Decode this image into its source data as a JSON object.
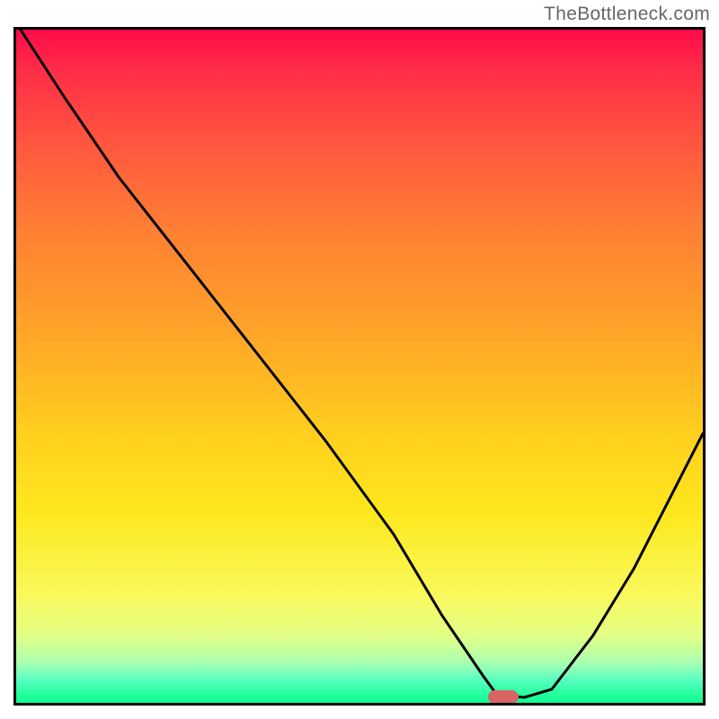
{
  "watermark": "TheBottleneck.com",
  "chart_data": {
    "type": "line",
    "title": "",
    "xlabel": "",
    "ylabel": "",
    "xlim": [
      0,
      100
    ],
    "ylim": [
      0,
      100
    ],
    "x": [
      0,
      7,
      15,
      25,
      35,
      45,
      55,
      62,
      68,
      70,
      74,
      78,
      84,
      90,
      100
    ],
    "values": [
      101,
      90,
      78,
      65,
      52,
      39,
      25,
      13,
      4,
      1.2,
      0.8,
      2,
      10,
      20,
      40
    ],
    "marker": {
      "x": 71,
      "y": 0.8
    },
    "colors": {
      "top": "#ff0b4a",
      "mid": "#ffcf1e",
      "bottom": "#0bff90",
      "marker": "#d86464",
      "line": "#000000"
    }
  }
}
